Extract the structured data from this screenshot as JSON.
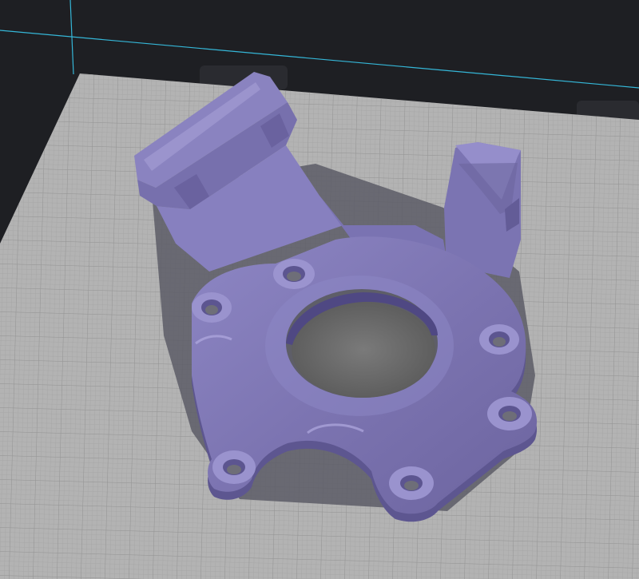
{
  "viewport": {
    "background_color": "#1e1f23",
    "bed_color": "#b3b3b3",
    "grid_color": "#9a9a9a",
    "build_volume_edge_color": "#35b7d8",
    "model_color": "#7f76b3",
    "model_shadow_color": "#5c5c66"
  },
  "scene": {
    "objects": [
      {
        "name": "printed-part-bracket",
        "icon": "part-mesh"
      }
    ]
  }
}
